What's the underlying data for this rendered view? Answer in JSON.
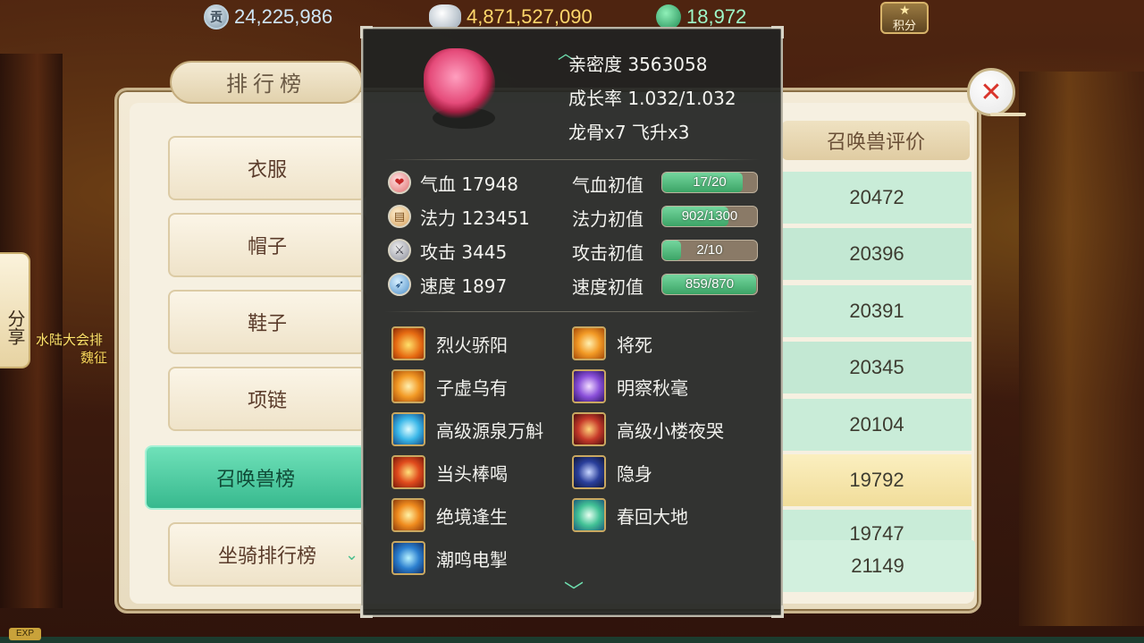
{
  "resources": [
    {
      "icon": "contribution-coin-icon",
      "glyph": "贡",
      "value": "24,225,986"
    },
    {
      "icon": "silver-ingot-icon",
      "glyph": "",
      "value": "4,871,527,090"
    },
    {
      "icon": "jade-icon",
      "glyph": "",
      "value": "18,972"
    }
  ],
  "points_button": {
    "label": "积分"
  },
  "panel": {
    "title": "排行榜",
    "tabs": [
      "衣服",
      "帽子",
      "鞋子",
      "项链",
      "召唤兽榜",
      "坐骑排行榜"
    ],
    "active_tab": "召唤兽榜"
  },
  "ranking": {
    "column_header": "召唤兽评价",
    "scores": [
      "20472",
      "20396",
      "20391",
      "20345",
      "20104",
      "19792",
      "19747",
      "21149"
    ]
  },
  "share": {
    "label": "分享",
    "note_line1": "水陆大会排",
    "note_line2": "魏征"
  },
  "pet_tooltip": {
    "intimacy": "亲密度 3563058",
    "growth": "成长率 1.032/1.032",
    "extras": "龙骨x7  飞升x3",
    "stats": [
      {
        "icon": "hp-heart-icon",
        "label": "气血 17948",
        "init_label": "气血初值",
        "current": 17,
        "max": 20,
        "text": "17/20"
      },
      {
        "icon": "mana-scroll-icon",
        "label": "法力 123451",
        "init_label": "法力初值",
        "current": 902,
        "max": 1300,
        "text": "902/1300"
      },
      {
        "icon": "attack-sword-icon",
        "label": "攻击 3445",
        "init_label": "攻击初值",
        "current": 2,
        "max": 10,
        "text": "2/10"
      },
      {
        "icon": "speed-feather-icon",
        "label": "速度 1897",
        "init_label": "速度初值",
        "current": 859,
        "max": 870,
        "text": "859/870"
      }
    ],
    "skills_left": [
      {
        "icon": "fire-skill-icon",
        "name": "烈火骄阳"
      },
      {
        "icon": "vortex-skill-icon",
        "name": "子虚乌有"
      },
      {
        "icon": "spring-skill-icon",
        "name": "高级源泉万斛"
      },
      {
        "icon": "strike-skill-icon",
        "name": "当头棒喝"
      },
      {
        "icon": "phoenix-skill-icon",
        "name": "绝境逢生"
      },
      {
        "icon": "thunder-skill-icon",
        "name": "潮鸣电掣"
      }
    ],
    "skills_right": [
      {
        "icon": "deathblow-skill-icon",
        "name": "将死"
      },
      {
        "icon": "insight-skill-icon",
        "name": "明察秋毫"
      },
      {
        "icon": "night-cry-skill-icon",
        "name": "高级小楼夜哭"
      },
      {
        "icon": "stealth-skill-icon",
        "name": "隐身"
      },
      {
        "icon": "revive-skill-icon",
        "name": "春回大地"
      }
    ]
  },
  "exp_tag": "EXP",
  "colors": {
    "accent_green": "#3ca466",
    "tab_active": "#37b98e",
    "highlight_row": "#f1dd9a"
  }
}
